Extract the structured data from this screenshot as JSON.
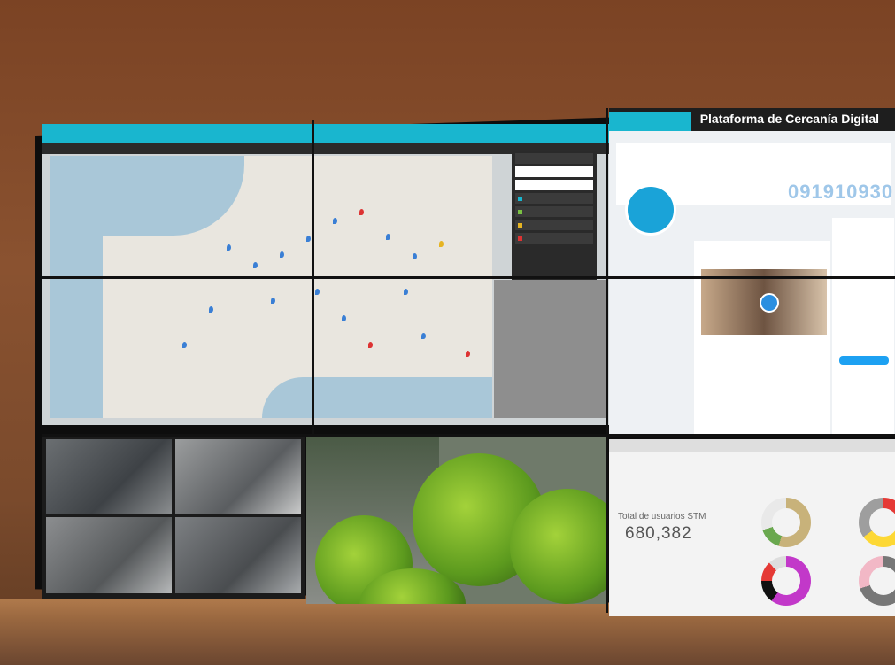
{
  "social": {
    "platform_title": "Plataforma de Cercanía Digital",
    "phone_number": "091910930"
  },
  "stats": {
    "users_label": "Total de usuarios STM",
    "users_value": "680,382"
  },
  "colors": {
    "accent_cyan": "#19b6cf",
    "wall_brown": "#7b4324",
    "twitter_blue": "#1da1f2"
  },
  "icons": {
    "map_pin": "map-pin-icon",
    "play": "play-icon",
    "whatsapp": "whatsapp-icon"
  }
}
